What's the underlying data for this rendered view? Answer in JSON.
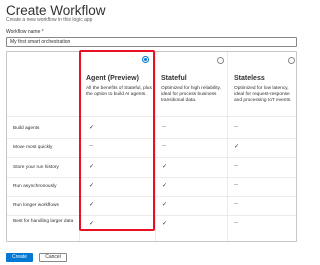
{
  "page": {
    "title": "Create Workflow",
    "subtitle": "Create a new workflow in this logic app"
  },
  "workflow_name": {
    "label": "Workflow name *",
    "value": "My first smart orchestration"
  },
  "options": [
    {
      "title": "Agent (Preview)",
      "description": "All the benefits of Stateful, plus the option to build AI agents.",
      "selected": true
    },
    {
      "title": "Stateful",
      "description": "Optimized for high reliability, ideal for process business transitional data.",
      "selected": false
    },
    {
      "title": "Stateless",
      "description": "Optimized for low latency, ideal for request-response and processing IoT events.",
      "selected": false
    }
  ],
  "features": [
    {
      "label": "Build agents",
      "values": [
        "✓",
        "--",
        "--"
      ]
    },
    {
      "label": "Move most quickly",
      "values": [
        "--",
        "--",
        "✓"
      ]
    },
    {
      "label": "Store your run history",
      "values": [
        "✓",
        "✓",
        "--"
      ]
    },
    {
      "label": "Run asynchronously",
      "values": [
        "✓",
        "✓",
        "--"
      ]
    },
    {
      "label": "Run longer workflows",
      "values": [
        "✓",
        "✓",
        "--"
      ]
    },
    {
      "label": "Best for handling larger data",
      "values": [
        "✓",
        "✓",
        "--"
      ]
    }
  ],
  "footer": {
    "create_label": "Create",
    "cancel_label": "Cancel"
  },
  "colors": {
    "primary": "#0078d4",
    "highlight": "#e81123"
  }
}
